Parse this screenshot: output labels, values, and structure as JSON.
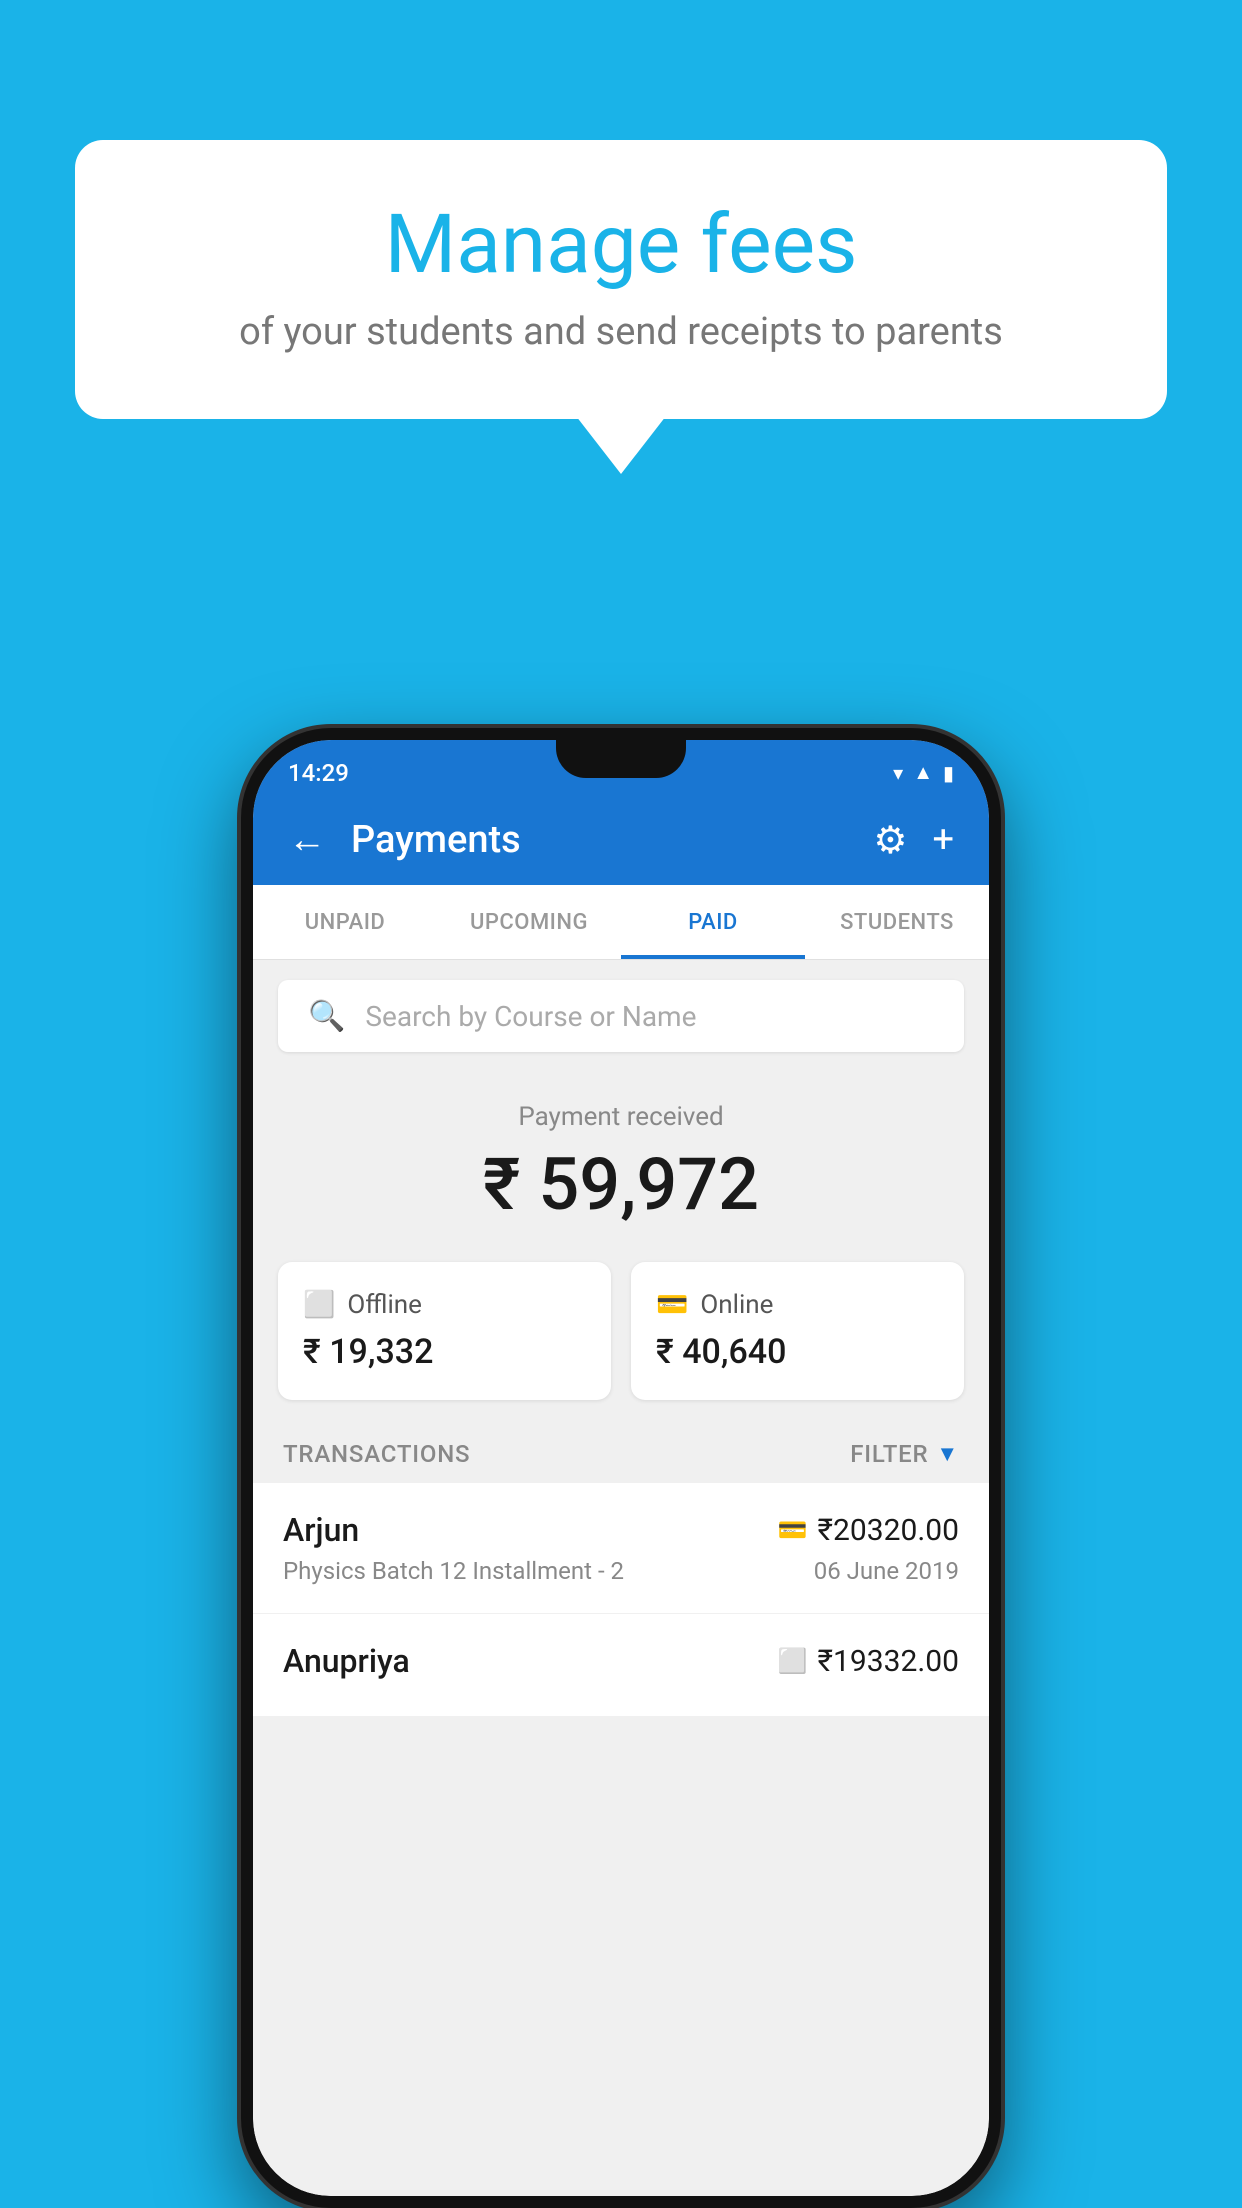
{
  "background_color": "#1ab3e8",
  "speech_bubble": {
    "title": "Manage fees",
    "subtitle": "of your students and send receipts to parents"
  },
  "status_bar": {
    "time": "14:29",
    "wifi": "▼",
    "signal": "▲",
    "battery": "■"
  },
  "app_bar": {
    "title": "Payments",
    "back_label": "←",
    "settings_label": "⚙",
    "add_label": "+"
  },
  "tabs": [
    {
      "label": "UNPAID",
      "active": false
    },
    {
      "label": "UPCOMING",
      "active": false
    },
    {
      "label": "PAID",
      "active": true
    },
    {
      "label": "STUDENTS",
      "active": false
    }
  ],
  "search": {
    "placeholder": "Search by Course or Name"
  },
  "payment_summary": {
    "label": "Payment received",
    "total": "₹ 59,972",
    "offline_label": "Offline",
    "offline_amount": "₹ 19,332",
    "online_label": "Online",
    "online_amount": "₹ 40,640"
  },
  "transactions": {
    "header_label": "TRANSACTIONS",
    "filter_label": "FILTER",
    "items": [
      {
        "name": "Arjun",
        "course": "Physics Batch 12 Installment - 2",
        "amount": "₹20320.00",
        "date": "06 June 2019",
        "type": "online"
      },
      {
        "name": "Anupriya",
        "course": "",
        "amount": "₹19332.00",
        "date": "",
        "type": "offline"
      }
    ]
  }
}
